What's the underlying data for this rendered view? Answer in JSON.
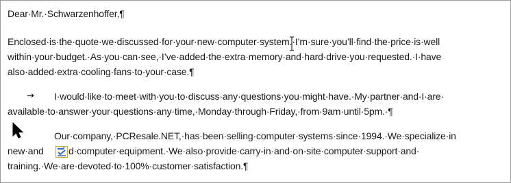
{
  "document": {
    "lines": {
      "salutation": "Dear·Mr.·Schwarzenhoffer,¶",
      "p1_l1": "Enclosed·is·the·quote·we·discussed·for·your·new·computer·system.·I’m·sure·you’ll·find·the·price·is·well",
      "p1_l2": "within·your·budget.·As·you·can·see,·I’ve·added·the·extra·memory·and·hard·drive·you·requested.·I·have",
      "p1_l3": "also·added·extra·cooling·fans·to·your·case.¶",
      "p2_tab": "→",
      "p2_l1": "I·would·like·to·meet·with·you·to·discuss·any·questions·you·might·have.·My·partner·and·I·are·",
      "p2_l2": "available·to·answer·your·questions·any·time,·Monday·through·Friday,·from·9am·until·5pm.·¶",
      "p3_l1": "Our·company,·PCResale.NET,·has·been·selling·computer·systems·since·1994.·We·specialize·in",
      "p3_l2a": "new·and",
      "p3_l2b": "d·computer·equipment.·We·also·provide·carry-in·and·on-site·computer·support·and·",
      "p3_l3": "training.·We·are·devoted·to·100%·customer·satisfaction.¶"
    }
  },
  "icons": {
    "text_cursor": "i-beam-cursor-icon",
    "pointer": "arrow-pointer-icon",
    "autocorrect": "autocorrect-options-icon"
  },
  "colors": {
    "border": "#9a9a9a",
    "text": "#1a1a1a",
    "autocorrect_border": "#d8a23a"
  }
}
